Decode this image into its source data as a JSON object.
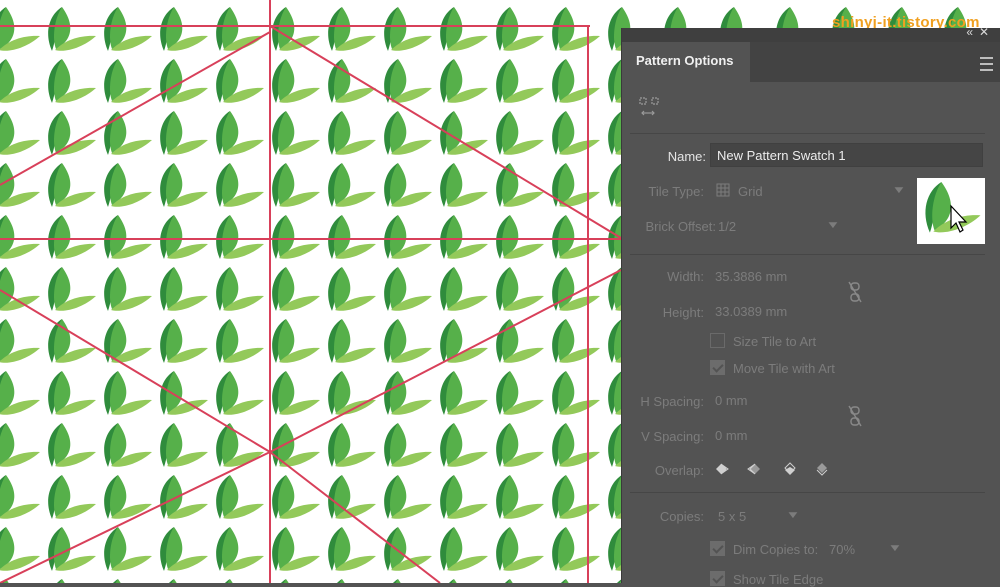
{
  "watermark": "shinyj-it.tistory.com",
  "panel": {
    "tab_label": "Pattern Options",
    "name_label": "Name:",
    "name_value": "New Pattern Swatch 1",
    "tile_type_label": "Tile Type:",
    "tile_type_value": "Grid",
    "brick_offset_label": "Brick Offset:",
    "brick_offset_value": "1/2",
    "width_label": "Width:",
    "width_value": "35.3886 mm",
    "height_label": "Height:",
    "height_value": "33.0389 mm",
    "size_tile_label": "Size Tile to Art",
    "move_tile_label": "Move Tile with Art",
    "h_spacing_label": "H Spacing:",
    "h_spacing_value": "0 mm",
    "v_spacing_label": "V Spacing:",
    "v_spacing_value": "0 mm",
    "overlap_label": "Overlap:",
    "copies_label": "Copies:",
    "copies_value": "5 x 5",
    "dim_copies_label": "Dim Copies to:",
    "dim_copies_value": "70%",
    "show_tile_edge_label": "Show Tile Edge"
  },
  "colors": {
    "panel_bg": "#535353",
    "leaf_dark": "#2f8c3c",
    "leaf_mid": "#56b04a",
    "leaf_light": "#93c95a",
    "guide_line": "#d8405a",
    "watermark": "#f0a020"
  },
  "icons": [
    "tile-edit-icon",
    "grid-icon",
    "chevron-down-icon",
    "link-icon",
    "checkbox-icon",
    "overlap-icon",
    "menu-icon",
    "collapse-icon",
    "close-icon"
  ]
}
